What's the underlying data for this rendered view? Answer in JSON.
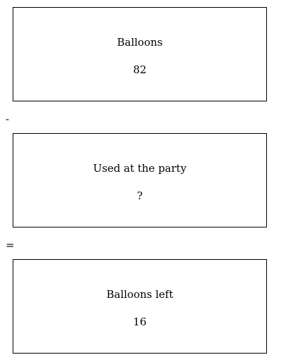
{
  "boxes": [
    {
      "label": "Balloons",
      "value": "82"
    },
    {
      "label": "Used at the party",
      "value": "?"
    },
    {
      "label": "Balloons left",
      "value": "16"
    }
  ],
  "operators": [
    "-",
    "="
  ]
}
